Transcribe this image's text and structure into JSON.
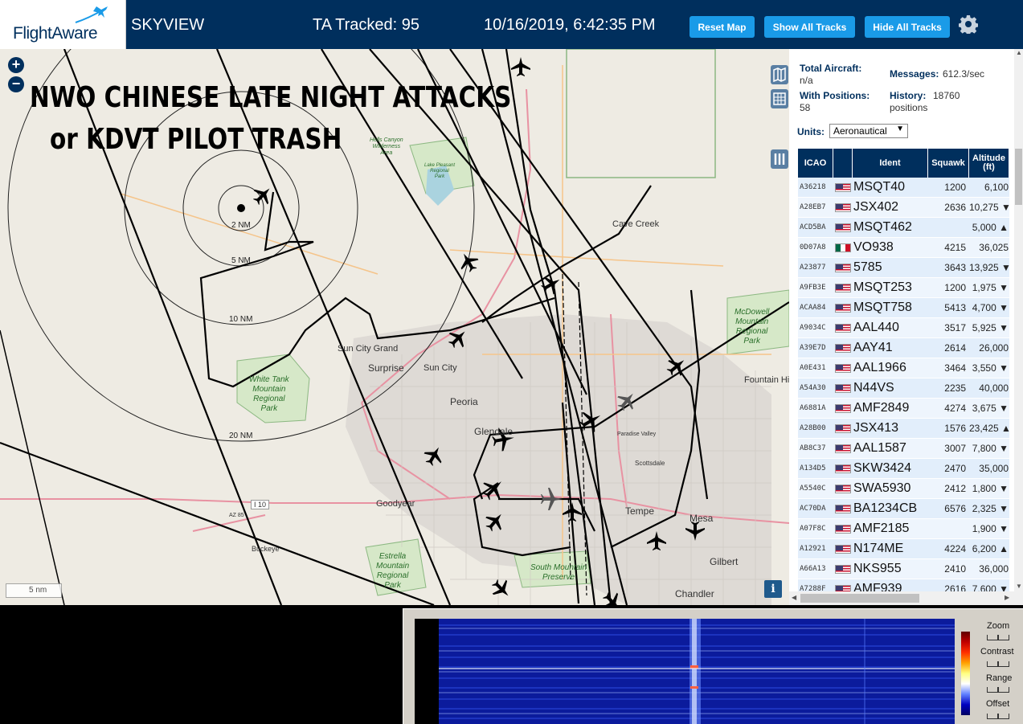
{
  "header": {
    "logo_text": "FlightAware",
    "app_title": "SKYVIEW",
    "ta_tracked": "TA Tracked: 95",
    "datetime": "10/16/2019, 6:42:35 PM",
    "reset_map": "Reset Map",
    "show_all_tracks": "Show All Tracks",
    "hide_all_tracks": "Hide All Tracks"
  },
  "map": {
    "overlay_line1": "NWO CHINESE LATE NIGHT ATTACKS",
    "overlay_line2": "or KDVT PILOT TRASH",
    "zoom_in": "+",
    "zoom_out": "−",
    "scale": "5 nm",
    "info": "i",
    "rings": [
      "2 NM",
      "5 NM",
      "10 NM",
      "20 NM"
    ],
    "places": {
      "cave_creek": "Cave Creek",
      "sun_city_grand": "Sun City Grand",
      "surprise": "Surprise",
      "sun_city": "Sun City",
      "peoria": "Peoria",
      "glendale": "Glendale",
      "goodyear": "Goodyear",
      "buckeye": "Buckeye",
      "tempe": "Tempe",
      "mesa": "Mesa",
      "chandler": "Chandler",
      "gilbert": "Gilbert",
      "fountain_hills": "Fountain Hi",
      "scottsdale": "Scottsdale",
      "paradise_valley": "Paradise Valley",
      "i10": "I 10",
      "az85": "AZ 85"
    },
    "parks": {
      "white_tank": "White Tank\nMountain\nRegional\nPark",
      "estrella": "Estrella\nMountain\nRegional\nPark",
      "south_mountain": "South Mountain\nPreserve",
      "mcdowell": "McDowell\nMountain\nRegional\nPark",
      "hells_canyon": "Hells Canyon\nWilderness\nArea",
      "lake_pleasant": "Lake Pleasant\nRegional\nPark"
    }
  },
  "stats": {
    "total_aircraft_label": "Total Aircraft:",
    "total_aircraft_value": "n/a",
    "with_positions_label": "With Positions:",
    "with_positions_value": "58",
    "messages_label": "Messages:",
    "messages_value": "612.3/sec",
    "history_label": "History:",
    "history_value": "18760",
    "history_unit": "positions",
    "units_label": "Units:",
    "units_value": "Aeronautical"
  },
  "table": {
    "headers": {
      "icao": "ICAO",
      "ident": "Ident",
      "squawk": "Squawk",
      "altitude": "Altitude (ft)"
    },
    "rows": [
      {
        "icao": "A36218",
        "flag": "us",
        "ident": "MSQT40",
        "squawk": "1200",
        "alt": "6,100"
      },
      {
        "icao": "A28EB7",
        "flag": "us",
        "ident": "JSX402",
        "squawk": "2636",
        "alt": "10,275 ▼"
      },
      {
        "icao": "ACD5BA",
        "flag": "us",
        "ident": "MSQT462",
        "squawk": "",
        "alt": "5,000 ▲"
      },
      {
        "icao": "0D07A8",
        "flag": "mx",
        "ident": "VO938",
        "squawk": "4215",
        "alt": "36,025"
      },
      {
        "icao": "A23877",
        "flag": "us",
        "ident": "5785",
        "squawk": "3643",
        "alt": "13,925 ▼"
      },
      {
        "icao": "A9FB3E",
        "flag": "us",
        "ident": "MSQT253",
        "squawk": "1200",
        "alt": "1,975 ▼"
      },
      {
        "icao": "ACAA84",
        "flag": "us",
        "ident": "MSQT758",
        "squawk": "5413",
        "alt": "4,700 ▼"
      },
      {
        "icao": "A9034C",
        "flag": "us",
        "ident": "AAL440",
        "squawk": "3517",
        "alt": "5,925 ▼"
      },
      {
        "icao": "A39E7D",
        "flag": "us",
        "ident": "AAY41",
        "squawk": "2614",
        "alt": "26,000"
      },
      {
        "icao": "A0E431",
        "flag": "us",
        "ident": "AAL1966",
        "squawk": "3464",
        "alt": "3,550 ▼"
      },
      {
        "icao": "A54A30",
        "flag": "us",
        "ident": "N44VS",
        "squawk": "2235",
        "alt": "40,000"
      },
      {
        "icao": "A6881A",
        "flag": "us",
        "ident": "AMF2849",
        "squawk": "4274",
        "alt": "3,675 ▼"
      },
      {
        "icao": "A28B00",
        "flag": "us",
        "ident": "JSX413",
        "squawk": "1576",
        "alt": "23,425 ▲"
      },
      {
        "icao": "AB8C37",
        "flag": "us",
        "ident": "AAL1587",
        "squawk": "3007",
        "alt": "7,800 ▼"
      },
      {
        "icao": "A134D5",
        "flag": "us",
        "ident": "SKW3424",
        "squawk": "2470",
        "alt": "35,000"
      },
      {
        "icao": "A5540C",
        "flag": "us",
        "ident": "SWA5930",
        "squawk": "2412",
        "alt": "1,800 ▼"
      },
      {
        "icao": "AC70DA",
        "flag": "us",
        "ident": "BA1234CB",
        "squawk": "6576",
        "alt": "2,325 ▼"
      },
      {
        "icao": "A07F8C",
        "flag": "us",
        "ident": "AMF2185",
        "squawk": "",
        "alt": "1,900 ▼"
      },
      {
        "icao": "A12921",
        "flag": "us",
        "ident": "N174ME",
        "squawk": "4224",
        "alt": "6,200 ▲"
      },
      {
        "icao": "A66A13",
        "flag": "us",
        "ident": "NKS955",
        "squawk": "2410",
        "alt": "36,000"
      },
      {
        "icao": "A7288F",
        "flag": "us",
        "ident": "AMF939",
        "squawk": "2616",
        "alt": "7,600 ▼"
      }
    ]
  },
  "waterfall": {
    "zoom": "Zoom",
    "contrast": "Contrast",
    "range": "Range",
    "offset": "Offset"
  },
  "colors": {
    "header_bg": "#002f5d",
    "button_bg": "#1a9be8",
    "map_bg": "#eeebe3"
  },
  "icons": {
    "gear": "gear-icon",
    "plane": "plane-icon",
    "map_layers": "map-icon",
    "grid": "grid-icon",
    "columns": "columns-icon"
  }
}
